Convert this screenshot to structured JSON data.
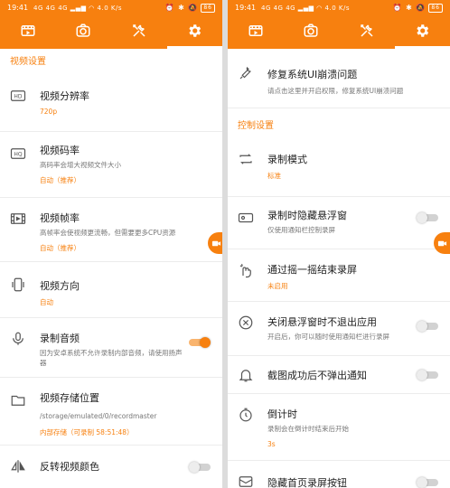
{
  "theme": {
    "accent": "#f7800f",
    "divider": "#ececec"
  },
  "status_bar": {
    "time": "19:41",
    "signal_text": "4G 4G 4G ▂▄▆ ◠ 4.0 K/s",
    "right_icons": "⏰ ✱ 🔕",
    "battery": "86"
  },
  "tabs": [
    {
      "label": "video-list",
      "icon": "film-icon",
      "active": false
    },
    {
      "label": "screenshot",
      "icon": "camera-icon",
      "active": false
    },
    {
      "label": "tools",
      "icon": "tools-icon",
      "active": false
    },
    {
      "label": "settings",
      "icon": "gear-icon",
      "active": true
    }
  ],
  "left": {
    "section_title": "视频设置",
    "items": [
      {
        "icon": "hd-icon",
        "title": "视频分辨率",
        "value": "720p"
      },
      {
        "icon": "hq-icon",
        "title": "视频码率",
        "subtitle": "高码率会增大视频文件大小",
        "value": "自动（推荐）"
      },
      {
        "icon": "film-strip-icon",
        "title": "视频帧率",
        "subtitle": "高帧率会使视频更流畅，但需要更多CPU资源",
        "value": "自动（推荐）"
      },
      {
        "icon": "phone-rotate-icon",
        "title": "视频方向",
        "value": "自动"
      },
      {
        "icon": "microphone-icon",
        "title": "录制音频",
        "subtitle": "因为安卓系统不允许录制内部音频，请使用扬声器",
        "toggle": true
      },
      {
        "icon": "folder-icon",
        "title": "视频存储位置",
        "subtitle": "/storage/emulated/0/recordmaster",
        "value": "内部存储（可录制 58:51:48）"
      },
      {
        "icon": "flip-icon",
        "title": "反转视频颜色",
        "toggle": false
      }
    ]
  },
  "right": {
    "items_top": [
      {
        "icon": "wrench-icon",
        "title": "修复系统UI崩溃问题",
        "subtitle": "请点击这里并开启权限，修复系统UI崩溃问题"
      }
    ],
    "section_title": "控制设置",
    "items": [
      {
        "icon": "loop-icon",
        "title": "录制模式",
        "value": "标准"
      },
      {
        "icon": "floating-window-icon",
        "title": "录制时隐藏悬浮窗",
        "subtitle": "仅使用通知栏控制录屏",
        "toggle": false
      },
      {
        "icon": "shake-icon",
        "title": "通过摇一摇结束录屏",
        "value": "未启用"
      },
      {
        "icon": "close-circle-icon",
        "title": "关闭悬浮窗时不退出应用",
        "subtitle": "开启后，你可以随时使用通知栏进行录屏",
        "toggle": false
      },
      {
        "icon": "bell-icon",
        "title": "截图成功后不弹出通知",
        "toggle": false
      },
      {
        "icon": "timer-icon",
        "title": "倒计时",
        "subtitle": "录制会在倒计时结束后开始",
        "value": "3s"
      },
      {
        "icon": "hide-home-icon",
        "title": "隐藏首页录屏按钮",
        "toggle": false
      }
    ]
  }
}
